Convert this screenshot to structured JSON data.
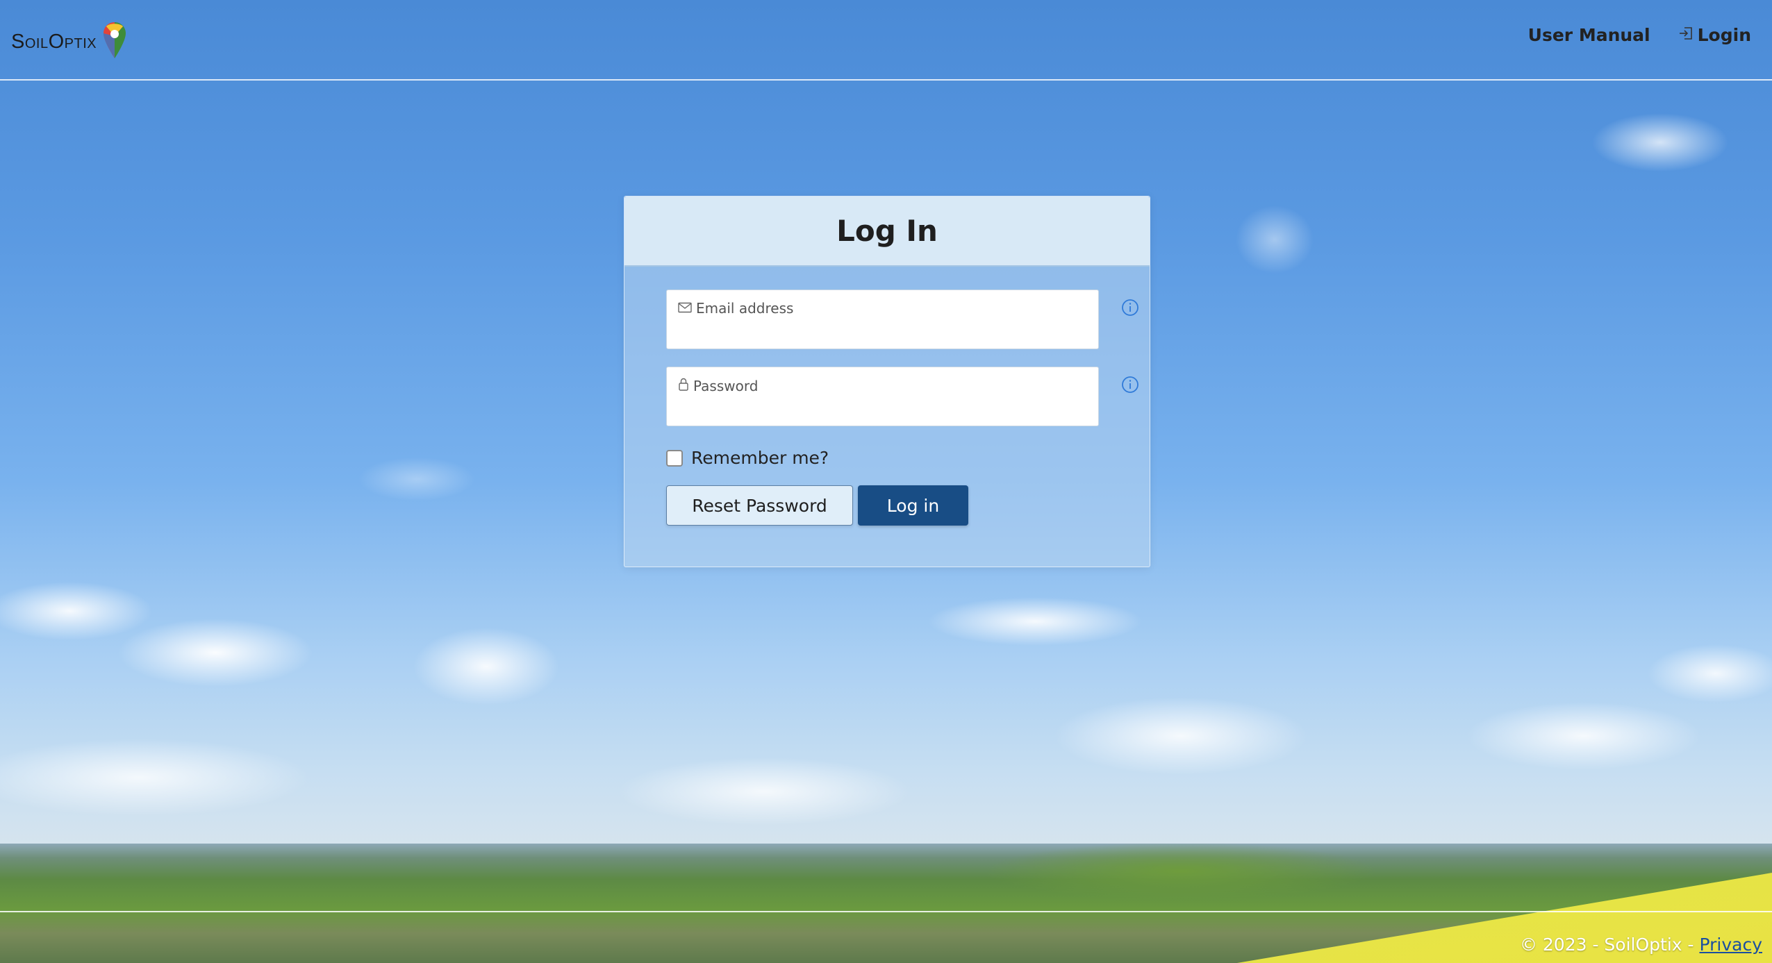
{
  "header": {
    "brand_name": "SoilOptix",
    "logo_icon": "map-pin-icon",
    "nav": {
      "user_manual": "User Manual",
      "login": "Login",
      "login_icon": "sign-in-icon"
    }
  },
  "login_card": {
    "title": "Log In",
    "email": {
      "label": "Email address",
      "icon": "envelope-icon",
      "value": ""
    },
    "password": {
      "label": "Password",
      "icon": "lock-icon",
      "value": ""
    },
    "info_icon": "info-circle-icon",
    "remember_me": {
      "label": "Remember me?",
      "checked": false
    },
    "buttons": {
      "reset_password": "Reset Password",
      "log_in": "Log in"
    }
  },
  "footer": {
    "copyright": "© 2023 - SoilOptix - ",
    "privacy_link": "Privacy"
  },
  "colors": {
    "primary_button": "#184d85",
    "card_header": "#d8e9f6",
    "info_icon": "#2f7ad8",
    "privacy_link": "#1a4fa0"
  }
}
